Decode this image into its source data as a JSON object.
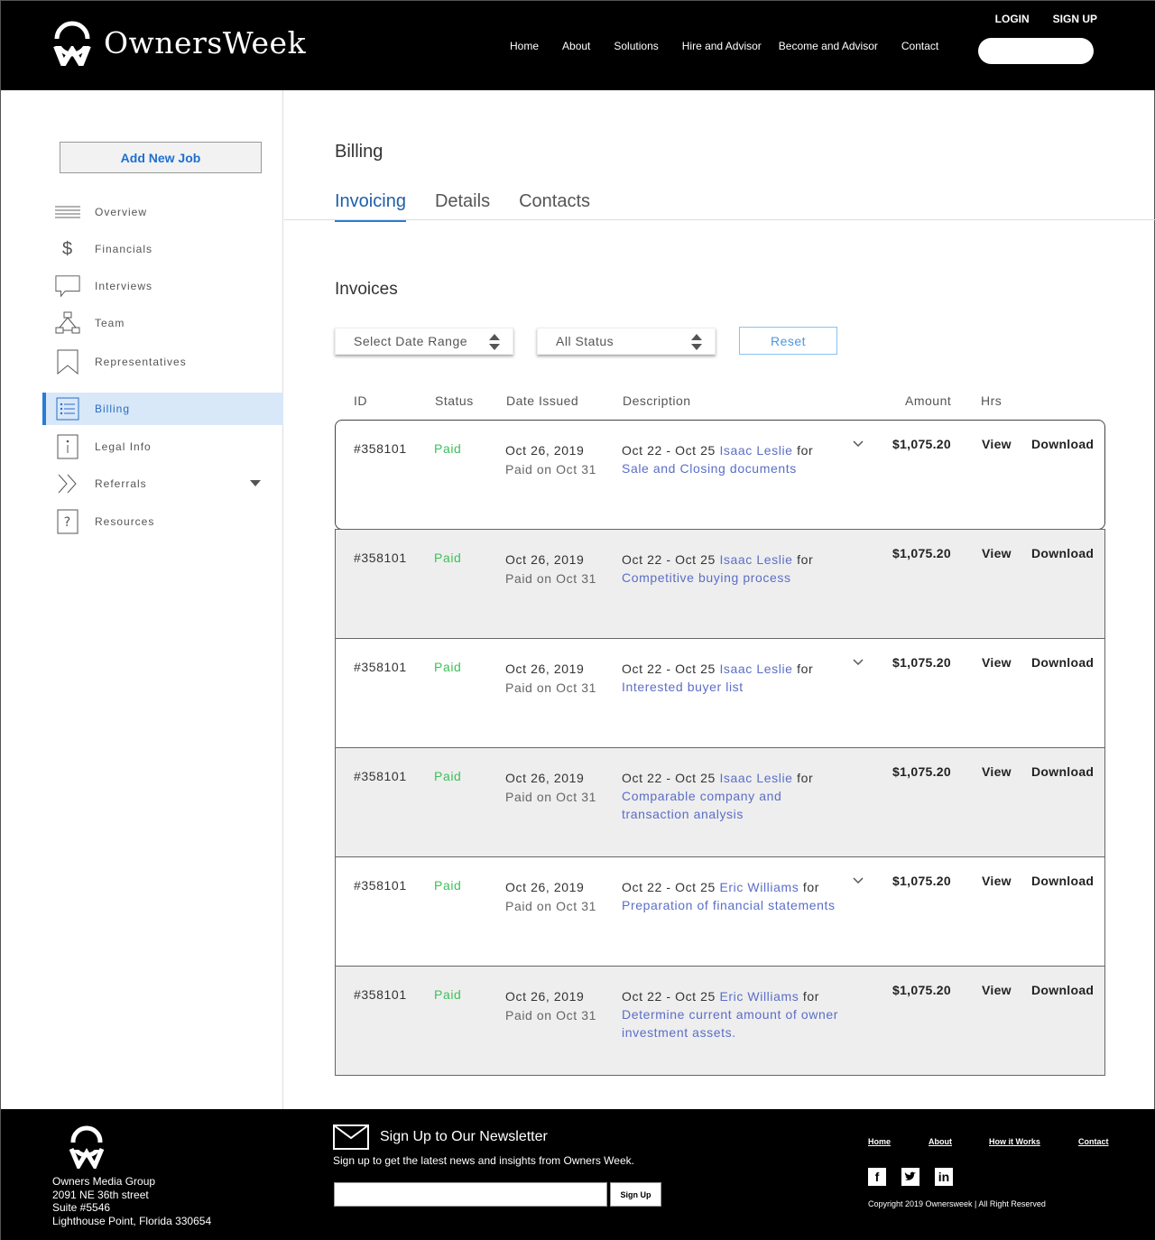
{
  "header": {
    "brand": "OwnersWeek",
    "login": "LOGIN",
    "signup": "SIGN UP",
    "nav": [
      "Home",
      "About",
      "Solutions",
      "Hire and Advisor",
      "Become and Advisor",
      "Contact"
    ],
    "search_value": ""
  },
  "sidebar": {
    "add_job": "Add New Job",
    "items": [
      {
        "label": "Overview",
        "icon": "menu-lines-icon"
      },
      {
        "label": "Financials",
        "icon": "dollar-icon"
      },
      {
        "label": "Interviews",
        "icon": "speech-bubble-icon"
      },
      {
        "label": "Team",
        "icon": "org-chart-icon"
      },
      {
        "label": "Representatives",
        "icon": "bookmark-icon"
      },
      {
        "label": "Billing",
        "icon": "list-icon"
      },
      {
        "label": "Legal Info",
        "icon": "info-icon"
      },
      {
        "label": "Referrals",
        "icon": "double-chevron-icon"
      },
      {
        "label": "Resources",
        "icon": "question-icon"
      }
    ]
  },
  "main": {
    "title": "Billing",
    "tabs": [
      "Invoicing",
      "Details",
      "Contacts"
    ],
    "section_title": "Invoices",
    "filters": {
      "date_range": "Select Date Range",
      "status": "All Status",
      "reset": "Reset"
    },
    "columns": [
      "ID",
      "Status",
      "Date Issued",
      "Description",
      "Amount",
      "Hrs"
    ],
    "rows": [
      {
        "id": "#358101",
        "status": "Paid",
        "date": "Oct 26, 2019",
        "paid_on": "Paid on Oct 31",
        "range": "Oct 22 - Oct 25",
        "person": "Isaac Leslie",
        "for": "for",
        "task": "Sale and Closing documents",
        "amount": "$1,075.20",
        "view": "View",
        "download": "Download"
      },
      {
        "id": "#358101",
        "status": "Paid",
        "date": "Oct 26, 2019",
        "paid_on": "Paid on Oct 31",
        "range": "Oct 22 - Oct 25",
        "person": "Isaac Leslie",
        "for": "for",
        "task": "Competitive buying process",
        "amount": "$1,075.20",
        "view": "View",
        "download": "Download"
      },
      {
        "id": "#358101",
        "status": "Paid",
        "date": "Oct 26, 2019",
        "paid_on": "Paid on Oct 31",
        "range": "Oct 22 - Oct 25",
        "person": "Isaac Leslie",
        "for": "for",
        "task": "Interested buyer list",
        "amount": "$1,075.20",
        "view": "View",
        "download": "Download"
      },
      {
        "id": "#358101",
        "status": "Paid",
        "date": "Oct 26, 2019",
        "paid_on": "Paid on Oct 31",
        "range": "Oct 22 - Oct 25",
        "person": "Isaac Leslie",
        "for": "for",
        "task": "Comparable company and transaction analysis",
        "amount": "$1,075.20",
        "view": "View",
        "download": "Download"
      },
      {
        "id": "#358101",
        "status": "Paid",
        "date": "Oct 26, 2019",
        "paid_on": "Paid on Oct 31",
        "range": "Oct 22 - Oct 25",
        "person": "Eric Williams",
        "for": "for",
        "task": "Preparation of financial statements",
        "amount": "$1,075.20",
        "view": "View",
        "download": "Download"
      },
      {
        "id": "#358101",
        "status": "Paid",
        "date": "Oct 26, 2019",
        "paid_on": "Paid on Oct 31",
        "range": "Oct 22 - Oct 25",
        "person": "Eric Williams",
        "for": "for",
        "task": "Determine current amount of owner investment assets.",
        "amount": "$1,075.20",
        "view": "View",
        "download": "Download"
      }
    ]
  },
  "footer": {
    "address": [
      "Owners Media Group",
      "2091 NE 36th street",
      "Suite #5546",
      "Lighthouse Point, Florida 330654"
    ],
    "newsletter_title": "Sign Up to Our Newsletter",
    "newsletter_sub": "Sign up to get the latest news and insights from Owners Week.",
    "signup_button": "Sign Up",
    "links": [
      "Home",
      "About",
      "How it Works",
      "Contact"
    ],
    "social": [
      "facebook-icon",
      "twitter-icon",
      "linkedin-icon"
    ],
    "copyright": "Copyright 2019 Ownersweek | All Right Reserved"
  },
  "colors": {
    "accent": "#2a7bd6",
    "paid": "#3cc15a",
    "link": "#5b6ec7",
    "header_bg": "#000000",
    "active_bg": "#d8e8f8"
  }
}
